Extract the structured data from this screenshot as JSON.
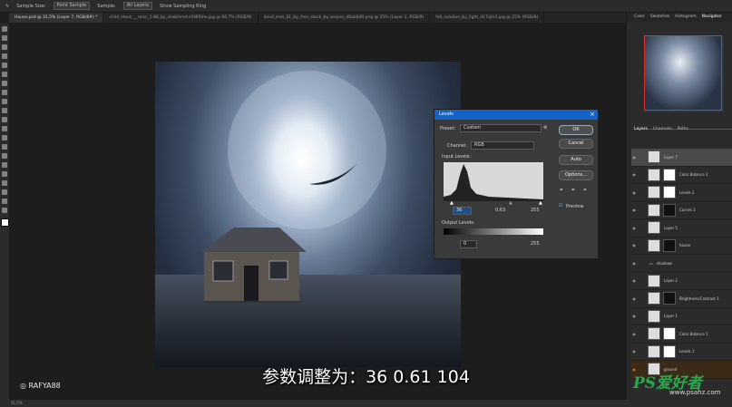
{
  "options_bar": {
    "sample_size_label": "Sample Size:",
    "sample_size_value": "Point Sample",
    "sample_label": "Sample:",
    "sample_value": "All Layers",
    "ring_label": "Show Sampling Ring"
  },
  "tabs": [
    {
      "label": "House.psd @ 31,5% (Layer 7, RGB/8#) *"
    },
    {
      "label": "child_stock___misc_1.88_by_skeblered.e5tBfbhe.jpg @ 66,7% (RGB/8)"
    },
    {
      "label": "dead_tree_01_by_free_stock_by_wayne_d6ab0d9.png @ 25% (Layer 1, RGB/8)"
    },
    {
      "label": "fall_solution_by_light_d17q0r3.jpg @ 25% (RGB/8)"
    }
  ],
  "levels_dialog": {
    "title": "Levels",
    "preset_label": "Preset:",
    "preset_value": "Custom",
    "channel_label": "Channel:",
    "channel_value": "RGB",
    "input_levels_label": "Input Levels:",
    "input_black": "36",
    "input_mid": "0,63",
    "input_white": "255",
    "output_levels_label": "Output Levels:",
    "output_black": "0",
    "output_white": "255",
    "buttons": {
      "ok": "OK",
      "cancel": "Cancel",
      "auto": "Auto",
      "options": "Options..."
    },
    "preview_label": "Preview"
  },
  "panel_tabs": [
    "Color",
    "Swatches",
    "Histogram",
    "Navigator"
  ],
  "layers_tabs": [
    "Layers",
    "Channels",
    "Paths"
  ],
  "layers": [
    {
      "name": "Layer 7",
      "selected": true
    },
    {
      "name": "Color Balance 2"
    },
    {
      "name": "Levels 2"
    },
    {
      "name": "Curves 1"
    },
    {
      "name": "Layer 5"
    },
    {
      "name": "house"
    },
    {
      "name": "shadows"
    },
    {
      "name": "Layer 2"
    },
    {
      "name": "Brightness/Contrast 1"
    },
    {
      "name": "Layer 1"
    },
    {
      "name": "Color Balance 1"
    },
    {
      "name": "Levels 1"
    },
    {
      "name": "ground"
    }
  ],
  "caption": "参数调整为：36 0.61 104",
  "watermark": "RAFYA88",
  "site_logo": "PS爱好者",
  "site_url": "www.psahz.com",
  "status": "31,5%"
}
